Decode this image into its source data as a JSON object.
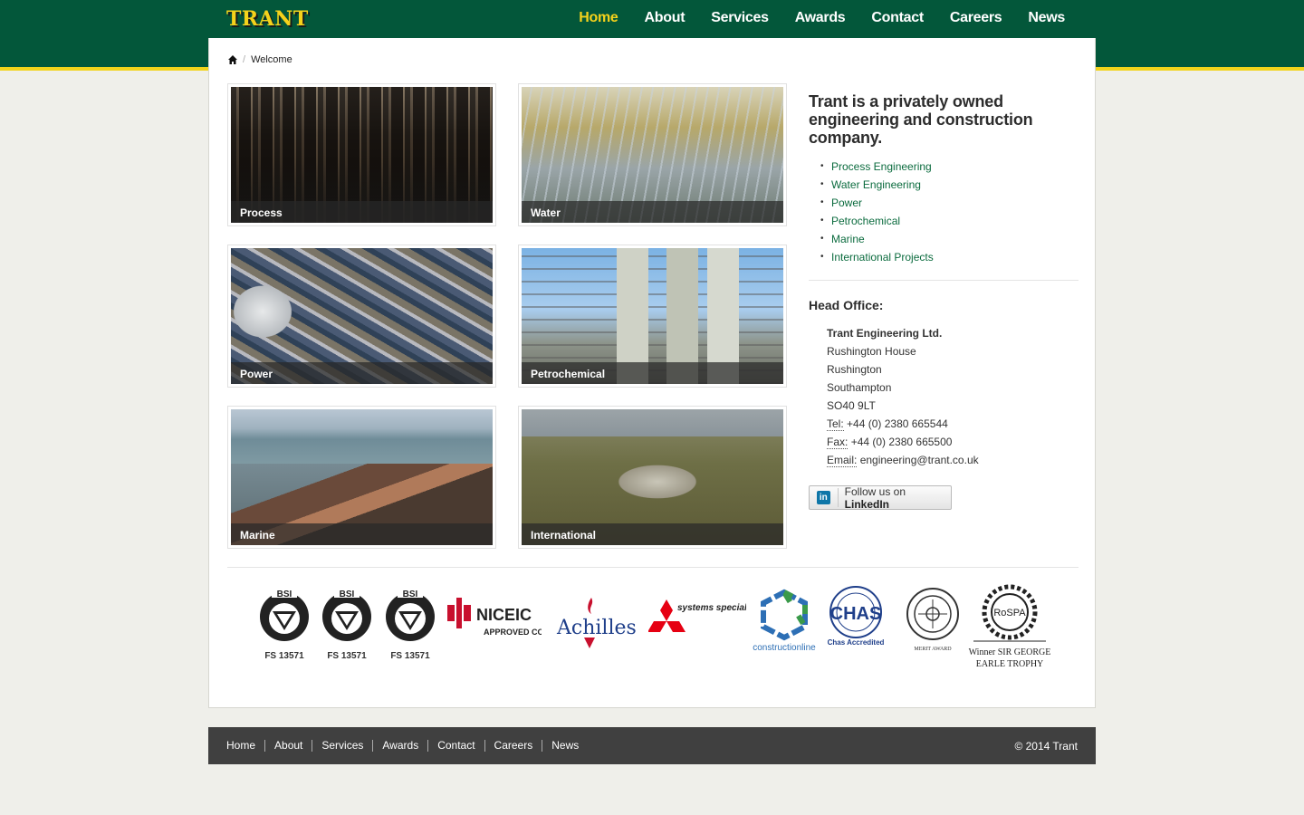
{
  "brand": {
    "logo_text": "TRANT",
    "primary_color": "#03573a",
    "accent_color": "#f5d21b"
  },
  "nav": {
    "items": [
      {
        "label": "Home",
        "active": true
      },
      {
        "label": "About"
      },
      {
        "label": "Services"
      },
      {
        "label": "Awards"
      },
      {
        "label": "Contact"
      },
      {
        "label": "Careers"
      },
      {
        "label": "News"
      }
    ]
  },
  "breadcrumb": {
    "icon": "home-icon",
    "current": "Welcome"
  },
  "tiles": [
    {
      "label": "Process"
    },
    {
      "label": "Water"
    },
    {
      "label": "Power"
    },
    {
      "label": "Petrochemical"
    },
    {
      "label": "Marine"
    },
    {
      "label": "International"
    }
  ],
  "intro": {
    "title": "Trant is a privately owned engineering and construction company.",
    "services": [
      "Process Engineering",
      "Water Engineering",
      "Power",
      "Petrochemical",
      "Marine",
      "International Projects"
    ]
  },
  "office": {
    "title": "Head Office:",
    "company": "Trant Engineering Ltd.",
    "lines": [
      "Rushington House",
      "Rushington",
      "Southampton",
      "SO40 9LT"
    ],
    "tel_label": "Tel:",
    "tel": "+44 (0) 2380 665544",
    "fax_label": "Fax:",
    "fax": "+44 (0) 2380 665500",
    "email_label": "Email:",
    "email": "engineering@trant.co.uk"
  },
  "linkedin": {
    "prefix": "Follow us on ",
    "brand": "LinkedIn"
  },
  "accreditations": [
    {
      "mark": "BSI",
      "caption": "FS 13571"
    },
    {
      "mark": "BSI",
      "caption": "FS 13571"
    },
    {
      "mark": "BSI",
      "caption": "FS 13571"
    },
    {
      "mark": "NICEIC",
      "caption": "APPROVED CONTRACTOR"
    },
    {
      "mark": "Achilles",
      "caption": ""
    },
    {
      "mark": "systems specialist",
      "caption": ""
    },
    {
      "mark": "constructionline",
      "caption": ""
    },
    {
      "mark": "CHAS",
      "caption": "Chas Accredited"
    },
    {
      "mark": "",
      "caption": "MERIT AWARD"
    },
    {
      "mark": "RoSPA",
      "caption": "Winner SIR GEORGE EARLE TROPHY"
    }
  ],
  "footer": {
    "links": [
      "Home",
      "About",
      "Services",
      "Awards",
      "Contact",
      "Careers",
      "News"
    ],
    "copyright": "© 2014 Trant"
  }
}
